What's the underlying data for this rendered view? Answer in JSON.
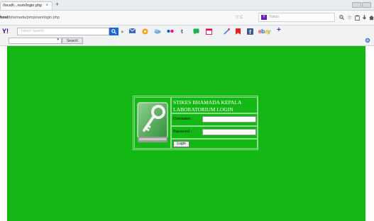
{
  "browser": {
    "tab_title": "/localh...num/login.php",
    "tab_close": "×",
    "new_tab": "+",
    "url_host": "host",
    "url_path": "/bhamada/pimpinan/login.php",
    "url_tools": "▽ C",
    "search_engine_badge": "Y",
    "search_placeholder": "Yahoo",
    "icons": [
      "search-icon",
      "star-icon",
      "clipboard-icon",
      "download-icon",
      "home-icon"
    ]
  },
  "toolbar": {
    "logo": "Y!",
    "search_placeholder": "Yahoo! Search",
    "search_button": "Search",
    "icons": [
      "search-go-icon",
      "mail-icon",
      "aol-icon",
      "weather-icon",
      "flickr-icon",
      "tumblr-icon",
      "answers-icon",
      "calendar-icon",
      "paint-icon",
      "bookmark-icon",
      "facebook-icon",
      "ebay-logo",
      "add-icon",
      "settings-icon"
    ],
    "ebay": {
      "e": "e",
      "b": "b",
      "a": "a",
      "y": "y"
    },
    "colors": {
      "ebay_e": "#e53238",
      "ebay_b": "#0064d2",
      "ebay_a": "#f5af02",
      "ebay_y": "#86b817"
    }
  },
  "login": {
    "title_line1": "STIKES BHAMADA KEPALA",
    "title_line2": "LABORATORIUM LOGIN",
    "username_label": "Username :",
    "username_value": "",
    "password_label": "Password :",
    "password_value": "",
    "button_label": "Login"
  },
  "colors": {
    "page_background": "#14b814",
    "title_text": "#ffffff",
    "table_border": "#8ede8e"
  }
}
